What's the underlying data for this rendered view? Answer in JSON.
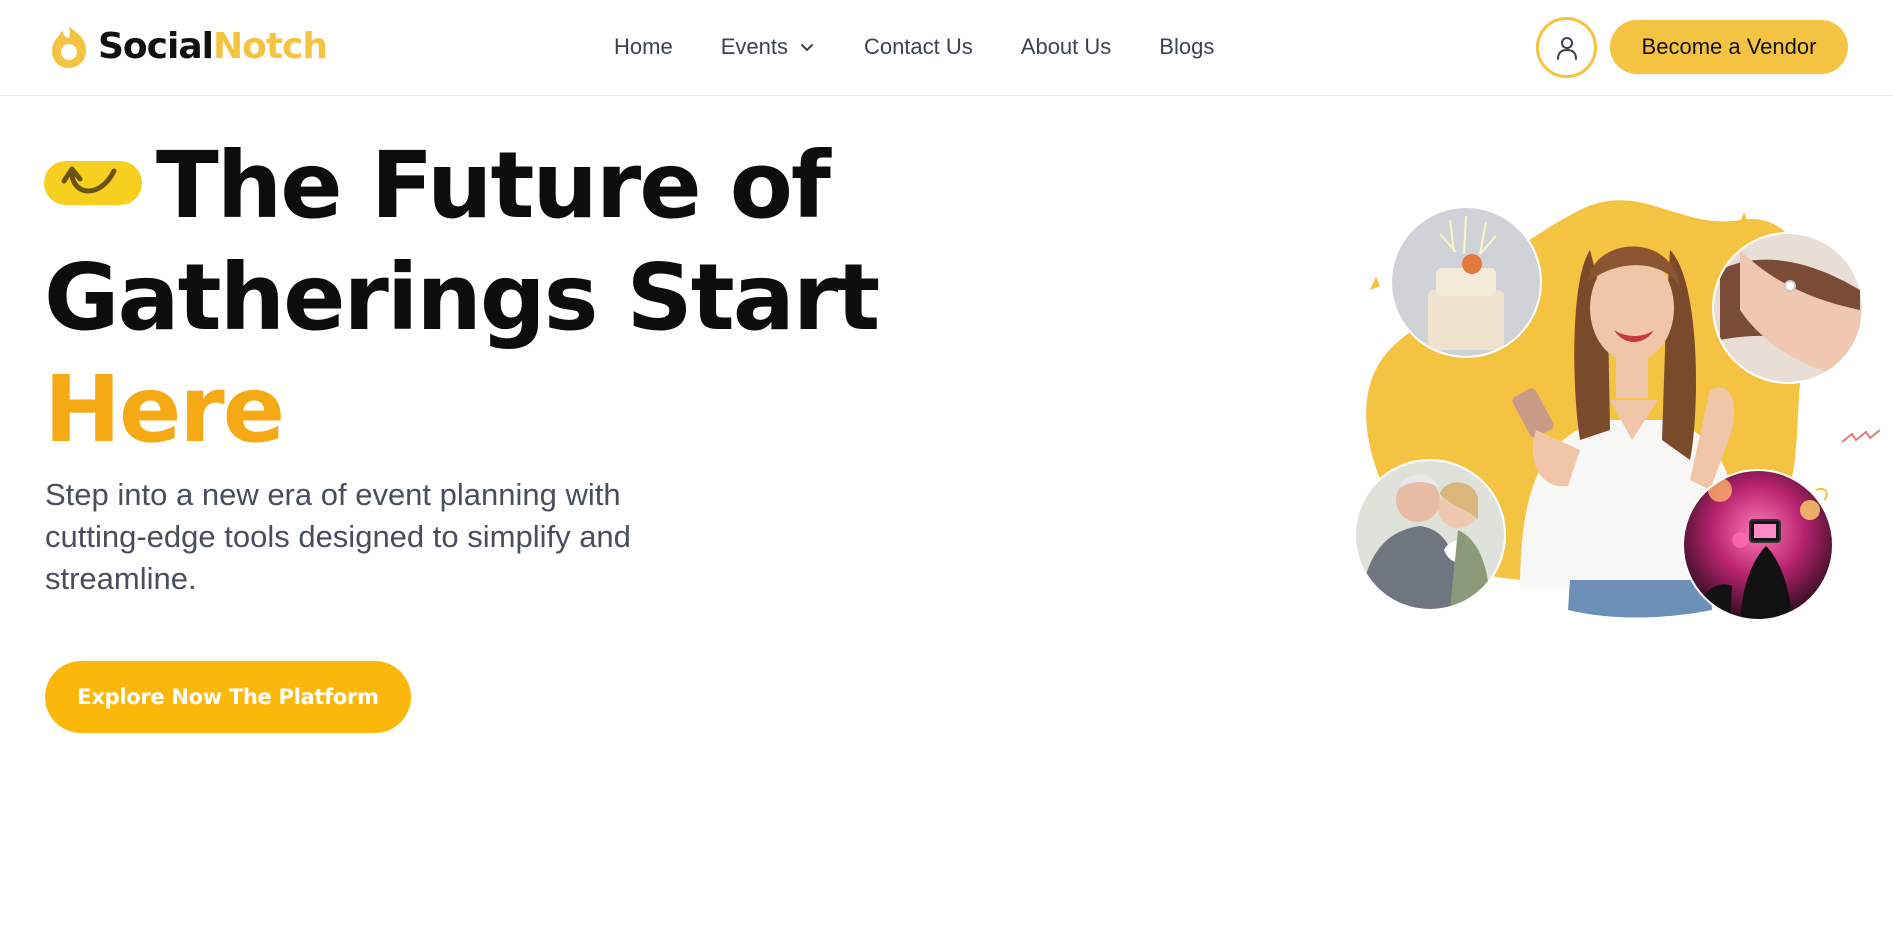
{
  "header": {
    "logo": {
      "part1": "Social",
      "part2": "Notch",
      "icon": "flame-logo-icon"
    },
    "nav": [
      {
        "label": "Home"
      },
      {
        "label": "Events",
        "icon": "chevron-down-icon"
      },
      {
        "label": "Contact Us"
      },
      {
        "label": "About Us"
      },
      {
        "label": "Blogs"
      }
    ],
    "user_icon": "user-icon",
    "vendor_button": "Become a Vendor"
  },
  "hero": {
    "title_line1": "The Future of",
    "title_line2": "Gatherings Start",
    "title_line3": "Here",
    "title_icon": "arrow-pill-icon",
    "subtitle_line1": "Step into a new era of event planning with",
    "subtitle_line2": "cutting-edge tools designed to simplify and",
    "subtitle_line3": "streamline.",
    "cta": "Explore Now The Platform"
  },
  "illustration": {
    "images": [
      "birthday-cake-photo",
      "ring-hands-photo",
      "smiling-woman-photo",
      "wedding-couple-photo",
      "concert-photo"
    ],
    "decorations": [
      "star-icon",
      "zigzag-icon"
    ]
  },
  "colors": {
    "brand_yellow": "#f5c342",
    "cta_yellow": "#fbb80b",
    "accent_orange": "#f5a914",
    "text_dark": "#0d0d0d",
    "text_muted": "#474f5e"
  }
}
